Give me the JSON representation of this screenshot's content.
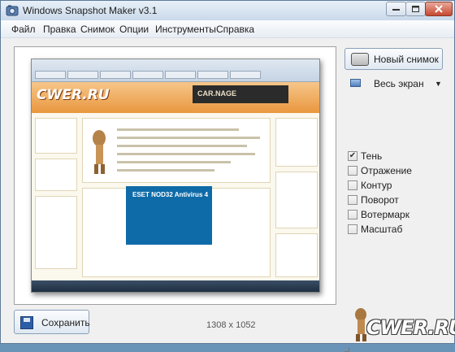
{
  "window": {
    "title": "Windows Snapshot Maker v3.1"
  },
  "menu": {
    "items": [
      {
        "label": "Файл"
      },
      {
        "label": "Правка"
      },
      {
        "label": "Снимок"
      },
      {
        "label": "Опции"
      },
      {
        "label": "Инструменты"
      },
      {
        "label": "Справка"
      }
    ]
  },
  "sidebar": {
    "new_snapshot_label": "Новый снимок",
    "capture_mode": "Весь экран",
    "effects": [
      {
        "label": "Тень",
        "checked": true
      },
      {
        "label": "Отражение",
        "checked": false
      },
      {
        "label": "Контур",
        "checked": false
      },
      {
        "label": "Поворот",
        "checked": false
      },
      {
        "label": "Вотермарк",
        "checked": false
      },
      {
        "label": "Масштаб",
        "checked": false
      }
    ]
  },
  "footer": {
    "save_label": "Сохранить",
    "dimensions": "1308 x 1052"
  },
  "preview": {
    "site_logo": "CWER.RU",
    "banner_text": "CAR.NAGE",
    "product_text": "ESET NOD32 Antivirus 4"
  },
  "watermark": {
    "text": "CWER.RU"
  },
  "icons": {
    "app": "app-icon",
    "camera": "camera-icon",
    "screen": "monitor-icon",
    "save": "floppy-disk-icon"
  }
}
